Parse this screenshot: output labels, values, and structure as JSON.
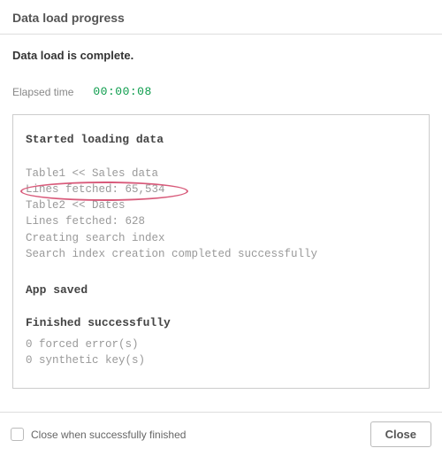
{
  "header": {
    "title": "Data load progress"
  },
  "status": {
    "message": "Data load is complete."
  },
  "elapsed": {
    "label": "Elapsed time",
    "time": "00:00:08"
  },
  "log": {
    "startTitle": "Started loading data",
    "lines": [
      "Table1 << Sales data",
      "Lines fetched: 65,534",
      "Table2 << Dates",
      "Lines fetched: 628",
      "Creating search index",
      "Search index creation completed successfully"
    ],
    "savedTitle": "App saved",
    "finishedTitle": "Finished successfully",
    "forced": "0 forced error(s)",
    "synthetic": "0 synthetic key(s)"
  },
  "footer": {
    "checkboxLabel": "Close when successfully finished",
    "closeLabel": "Close"
  }
}
